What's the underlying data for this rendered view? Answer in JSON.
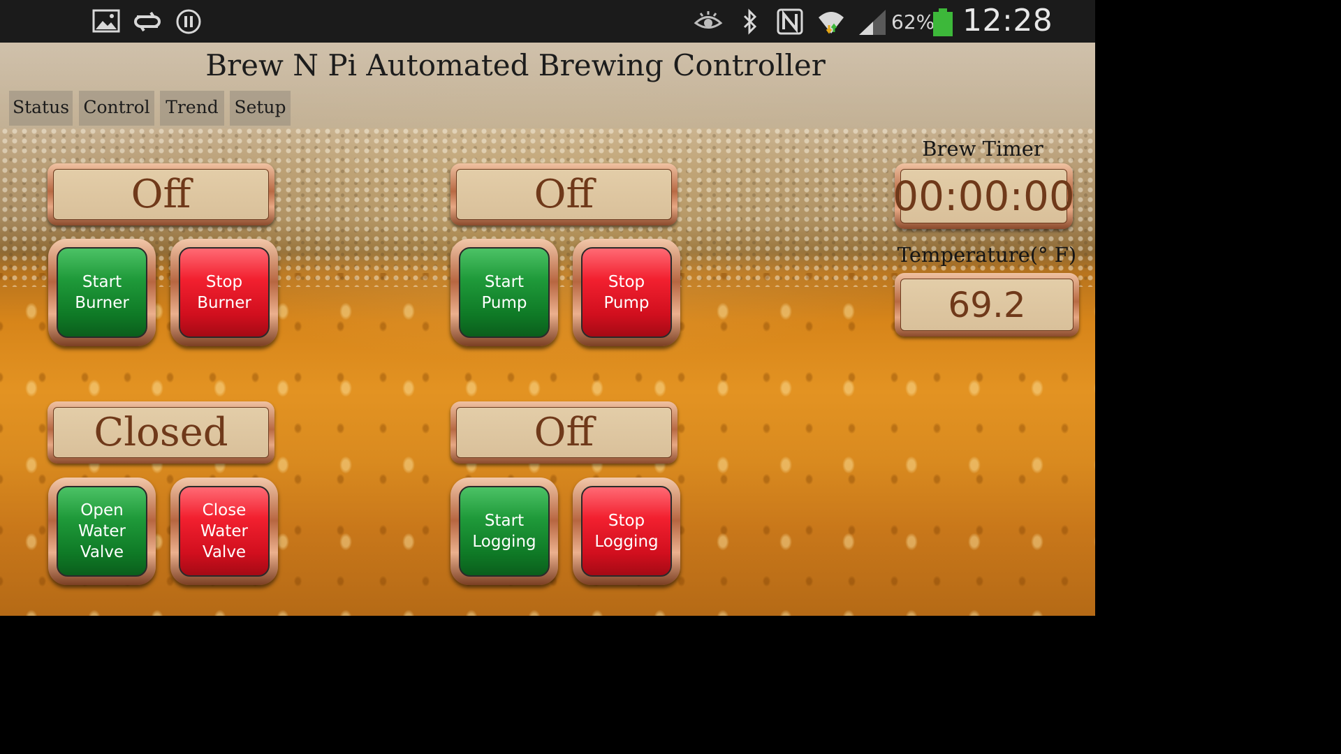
{
  "status_bar": {
    "icons": [
      "gallery-icon",
      "sync-icon",
      "pause-icon",
      "eye-icon",
      "bluetooth-icon",
      "nfc-icon",
      "wifi-icon",
      "signal-icon",
      "battery-icon"
    ],
    "battery_percent": "62%",
    "clock": "12:28 AM",
    "battery_color": "#3db83a"
  },
  "app": {
    "title": "Brew N Pi Automated Brewing Controller",
    "tabs": [
      {
        "label": "Status"
      },
      {
        "label": "Control"
      },
      {
        "label": "Trend"
      },
      {
        "label": "Setup"
      }
    ]
  },
  "burner": {
    "status": "Off",
    "start_label": "Start\nBurner",
    "stop_label": "Stop\nBurner"
  },
  "pump": {
    "status": "Off",
    "start_label": "Start\nPump",
    "stop_label": "Stop\nPump"
  },
  "water_valve": {
    "status": "Closed",
    "open_label": "Open\nWater\nValve",
    "close_label": "Close\nWater\nValve"
  },
  "logging": {
    "status": "Off",
    "start_label": "Start\nLogging",
    "stop_label": "Stop\nLogging"
  },
  "brew_timer": {
    "label": "Brew Timer",
    "value": "00:00:00"
  },
  "temperature": {
    "label": "Temperature(° F)",
    "value": "69.2"
  },
  "colors": {
    "start_button": "#1f9a3a",
    "stop_button": "#e81c2b",
    "display_text": "#6f391a"
  }
}
